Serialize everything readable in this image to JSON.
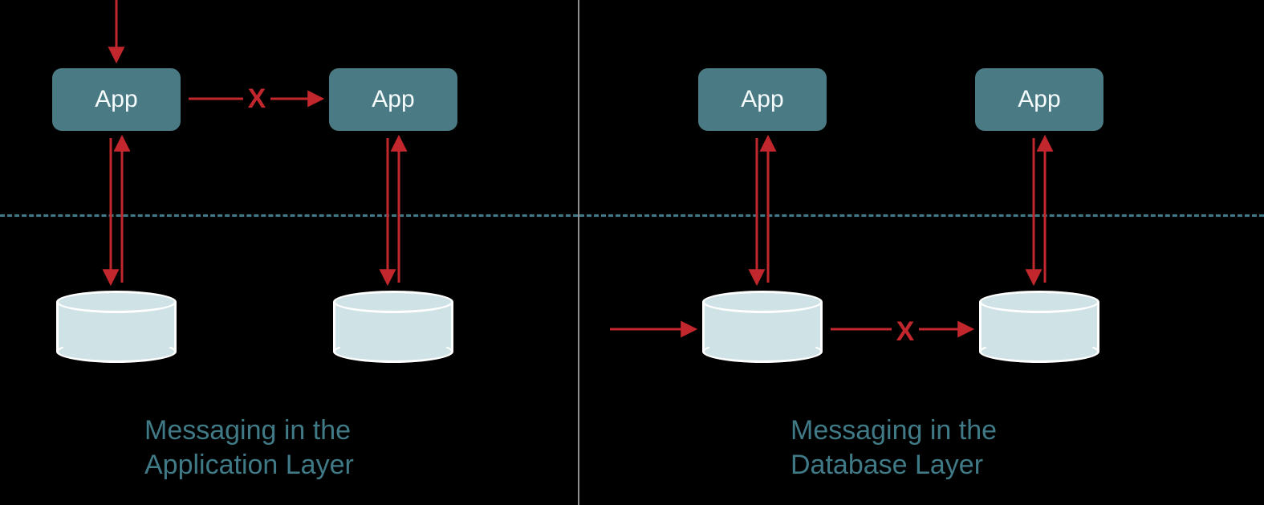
{
  "left": {
    "app1_label": "App",
    "app2_label": "App",
    "caption": "Messaging in the\nApplication Layer",
    "x_label": "X"
  },
  "right": {
    "app1_label": "App",
    "app2_label": "App",
    "caption": "Messaging in the\nDatabase Layer",
    "x_label": "X"
  }
}
